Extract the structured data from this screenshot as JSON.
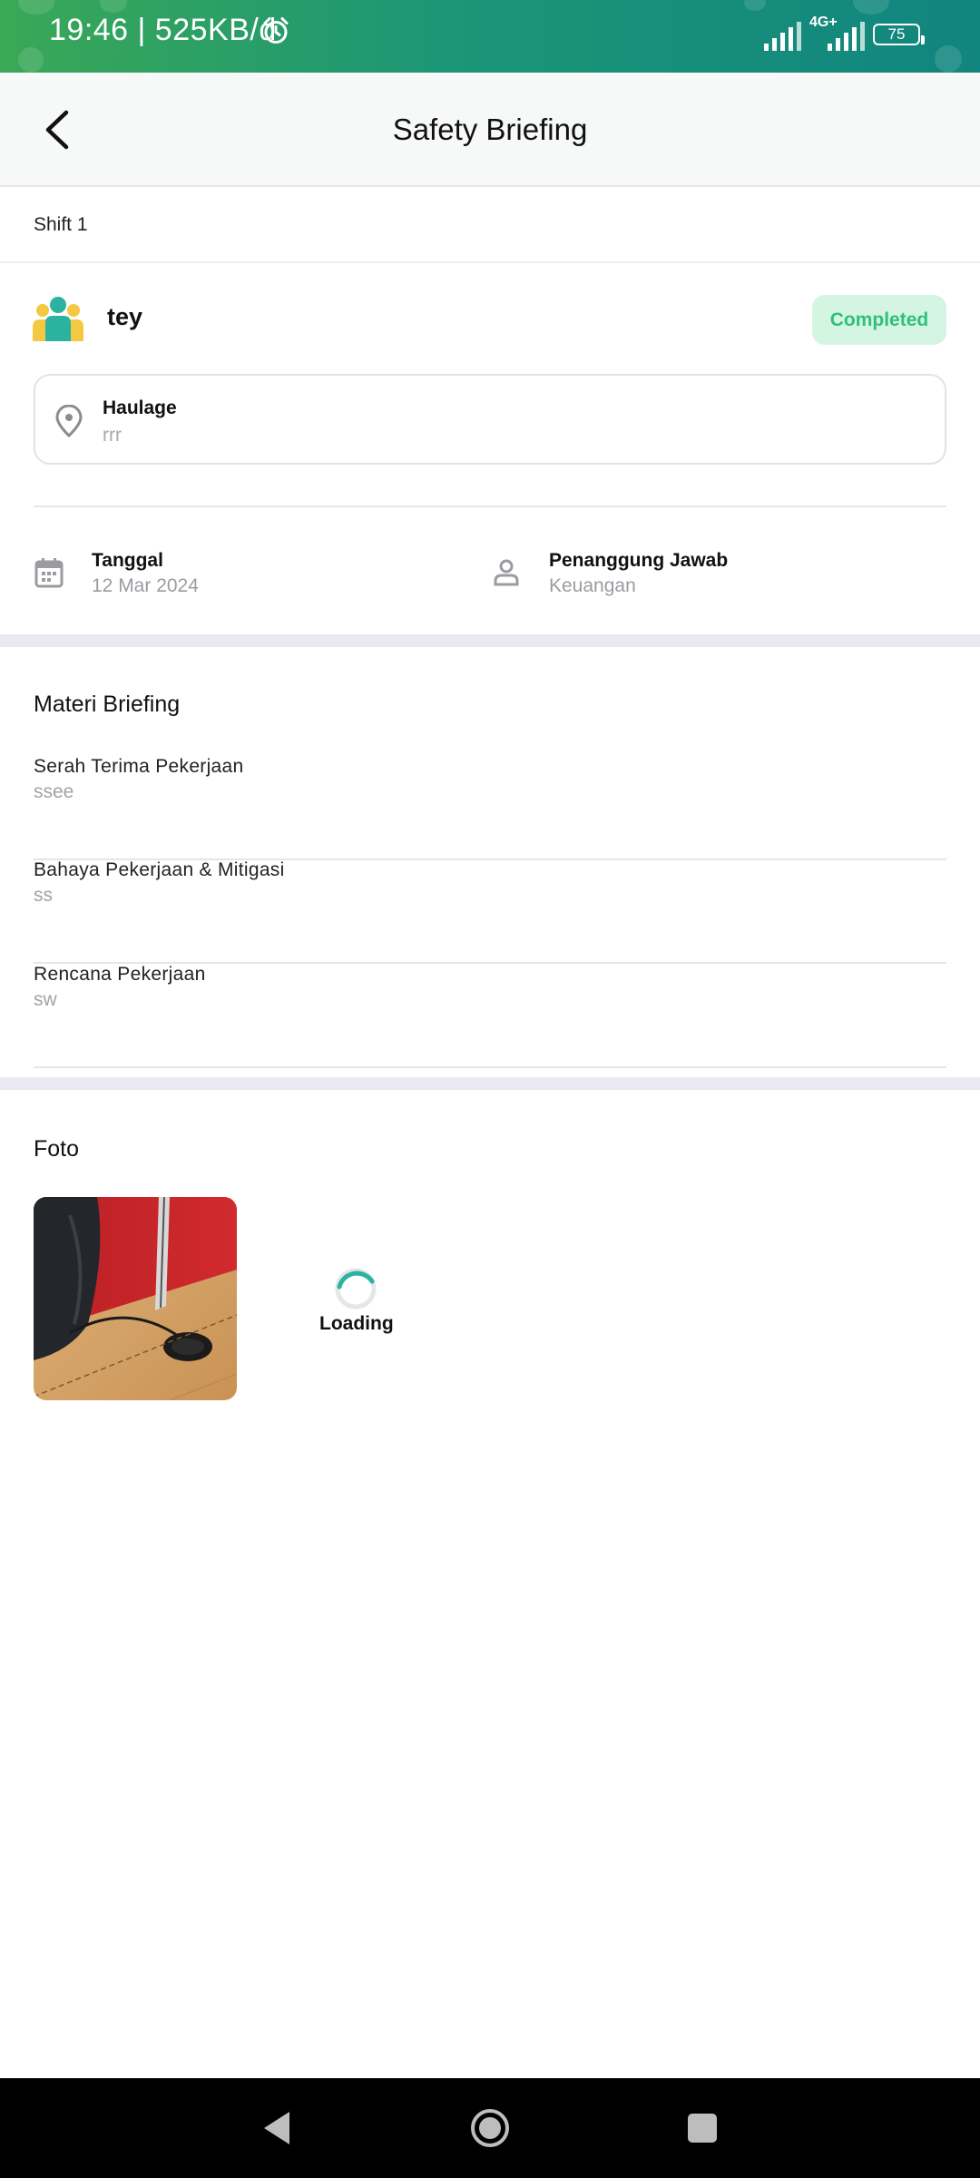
{
  "status_bar": {
    "time_speed": "19:46 | 525KB/d",
    "network": "4G+",
    "battery": "75"
  },
  "header": {
    "title": "Safety Briefing"
  },
  "shift": {
    "label": "Shift 1"
  },
  "team": {
    "name": "tey",
    "status": "Completed",
    "status_color": "#2fc17a"
  },
  "location": {
    "title": "Haulage",
    "subtitle": "rrr"
  },
  "info": {
    "date_label": "Tanggal",
    "date_value": "12 Mar 2024",
    "pic_label": "Penanggung Jawab",
    "pic_value": "Keuangan"
  },
  "briefing": {
    "title": "Materi Briefing",
    "items": [
      {
        "title": "Serah Terima Pekerjaan",
        "value": "ssee"
      },
      {
        "title": "Bahaya Pekerjaan & Mitigasi",
        "value": "ss"
      },
      {
        "title": "Rencana Pekerjaan",
        "value": "sw"
      }
    ]
  },
  "photos": {
    "title": "Foto",
    "loading_text": "Loading",
    "loader_color": "#2bb3a0"
  }
}
